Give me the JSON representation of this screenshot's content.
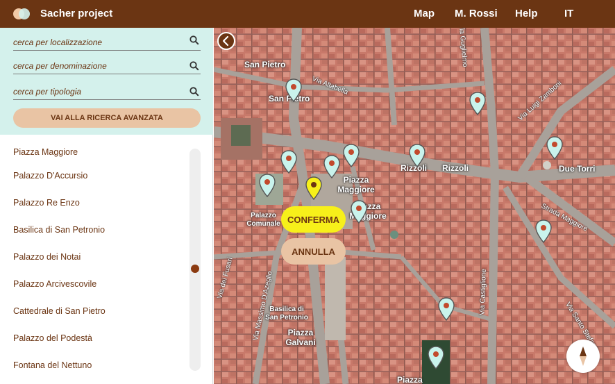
{
  "header": {
    "app_title": "Sacher project",
    "nav": [
      "Map",
      "M. Rossi",
      "Help",
      "IT"
    ]
  },
  "search": {
    "location_placeholder": "cerca per localizzazione",
    "name_placeholder": "cerca per denominazione",
    "type_placeholder": "cerca per tipologia",
    "advanced_label": "VAI ALLA RICERCA AVANZATA"
  },
  "places": [
    "Piazza Maggiore",
    "Palazzo D'Accursio",
    "Palazzo Re Enzo",
    "Basilica di San Petronio",
    "Palazzo dei Notai",
    "Palazzo Arcivescovile",
    "Cattedrale di San Pietro",
    "Palazzo del Podestà",
    "Fontana del Nettuno"
  ],
  "map": {
    "labels": {
      "san_pietro_top": "San Pietro",
      "san_pietro": "San Pietro",
      "piazza_maggiore": "Piazza Maggiore",
      "piazza_maggiore_2": "Piazza Maggiore",
      "palazzo_comunale": "Palazzo Comunale",
      "rizzoli_1": "Rizzoli",
      "rizzoli_2": "Rizzoli",
      "due_torri": "Due Torri",
      "basilica": "Basilica di San Petronio",
      "piazza_galvani": "Piazza Galvani",
      "piazza_bottom": "Piazza"
    },
    "streets": {
      "altabella": "Via Altabella",
      "zamboni": "Via Luigi Zamboni",
      "strada_maggiore": "Strada Maggiore",
      "castiglione": "Via Castiglione",
      "fusari": "Via dei Fusari",
      "azeglio": "Via Massimo D'Azeglio",
      "santo_stefano": "Via Santo Stefano",
      "guglielmo": "Via Guglielmo"
    },
    "confirm_label": "CONFERMA",
    "cancel_label": "ANNULLA"
  },
  "icons": {
    "search": "search-icon",
    "collapse": "chevron-left-icon",
    "pin": "map-pin-icon",
    "compass": "compass-icon",
    "logo": "logo-icon"
  },
  "colors": {
    "header": "#6b3513",
    "search_panel": "#d4f1ec",
    "accent_button": "#e9c4a4",
    "confirm": "#f7f01a",
    "pin_fill": "#c9f3ec",
    "pin_selected": "#f7f01a",
    "pin_dot": "#c24a2d"
  }
}
